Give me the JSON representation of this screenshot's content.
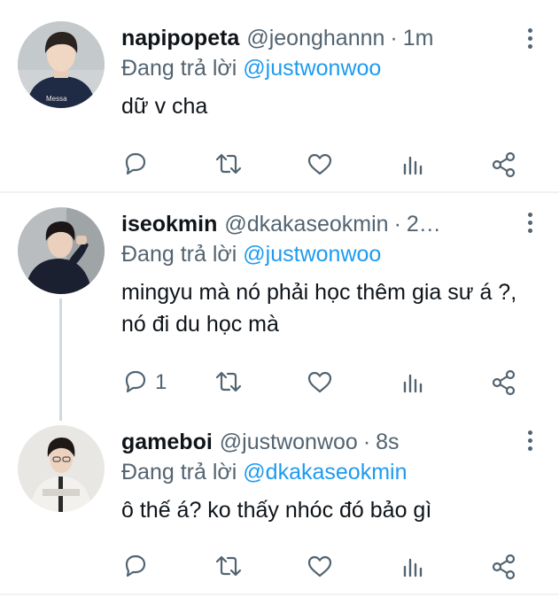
{
  "colors": {
    "accent": "#1d9bf0",
    "secondary_text": "#536471",
    "divider": "#eff3f4"
  },
  "tweets": [
    {
      "name": "napipopeta",
      "handle": "@jeonghannn",
      "separator": "·",
      "time": "1m",
      "reply_prefix": "Đang trả lời",
      "reply_to": "@justwonwoo",
      "text": "dữ v cha",
      "reply_count": "",
      "icons": [
        "reply-icon",
        "retweet-icon",
        "like-icon",
        "analytics-icon",
        "share-icon"
      ]
    },
    {
      "name": "iseokmin",
      "handle": "@dkakaseokmin",
      "separator": "·",
      "time": "2…",
      "reply_prefix": "Đang trả lời",
      "reply_to": "@justwonwoo",
      "text": "mingyu mà nó phải học thêm gia sư á ?, nó đi du học mà",
      "reply_count": "1",
      "icons": [
        "reply-icon",
        "retweet-icon",
        "like-icon",
        "analytics-icon",
        "share-icon"
      ]
    },
    {
      "name": "gameboi",
      "handle": "@justwonwoo",
      "separator": "·",
      "time": "8s",
      "reply_prefix": "Đang trả lời",
      "reply_to": "@dkakaseokmin",
      "text": "ô thế á? ko thấy nhóc đó bảo gì",
      "reply_count": "",
      "icons": [
        "reply-icon",
        "retweet-icon",
        "like-icon",
        "analytics-icon",
        "share-icon"
      ]
    }
  ]
}
